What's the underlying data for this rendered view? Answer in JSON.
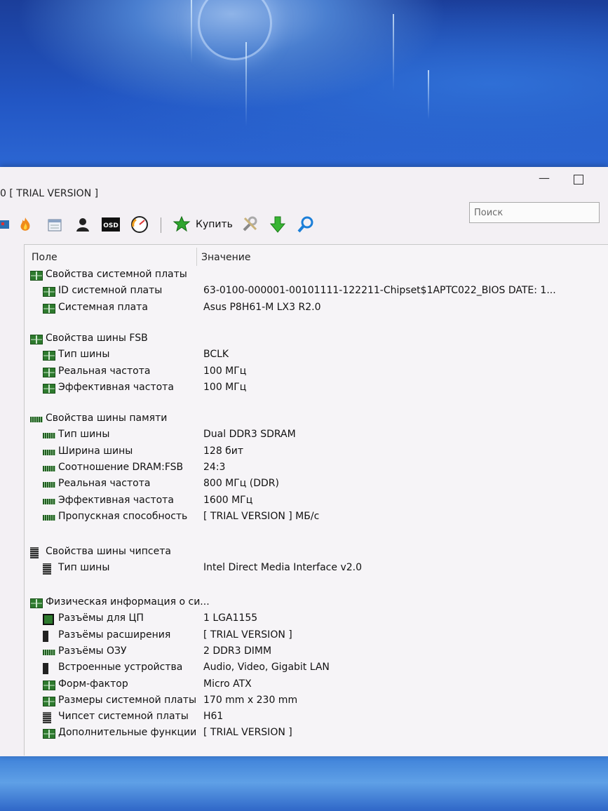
{
  "window": {
    "title": "0  [ TRIAL VERSION ]",
    "minimize_glyph": "—",
    "maximize_glyph": ""
  },
  "toolbar": {
    "icons": [
      "board-icon",
      "flame-icon",
      "calendar-icon",
      "user-icon",
      "osd-icon",
      "gauge-icon",
      "buy-icon",
      "tools-icon",
      "download-icon",
      "search-icon"
    ],
    "osd_text": "OSD",
    "buy_label": "Купить"
  },
  "search": {
    "placeholder": "Поиск",
    "value": ""
  },
  "columns": {
    "field": "Поле",
    "value": "Значение"
  },
  "groups": [
    {
      "title": "Свойства системной платы",
      "rows": [
        {
          "label": "ID системной платы",
          "value": "63-0100-000001-00101111-122211-Chipset$1APTC022_BIOS DATE: 1..."
        },
        {
          "label": "Системная плата",
          "value": "Asus P8H61-M LX3 R2.0"
        }
      ]
    },
    {
      "title": "Свойства шины FSB",
      "rows": [
        {
          "label": "Тип шины",
          "value": "BCLK"
        },
        {
          "label": "Реальная частота",
          "value": "100 МГц"
        },
        {
          "label": "Эффективная частота",
          "value": "100 МГц"
        }
      ]
    },
    {
      "title": "Свойства шины памяти",
      "rows": [
        {
          "label": "Тип шины",
          "value": "Dual DDR3 SDRAM"
        },
        {
          "label": "Ширина шины",
          "value": "128 бит"
        },
        {
          "label": "Соотношение DRAM:FSB",
          "value": "24:3"
        },
        {
          "label": "Реальная частота",
          "value": "800 МГц (DDR)"
        },
        {
          "label": "Эффективная частота",
          "value": "1600 МГц"
        },
        {
          "label": "Пропускная способность",
          "value": "[ TRIAL VERSION ] МБ/с"
        }
      ]
    },
    {
      "title": "Свойства шины чипсета",
      "rows": [
        {
          "label": "Тип шины",
          "value": "Intel Direct Media Interface v2.0"
        }
      ]
    },
    {
      "title": "Физическая информация о си...",
      "rows": [
        {
          "label": "Разъёмы для ЦП",
          "value": "1 LGA1155"
        },
        {
          "label": "Разъёмы расширения",
          "value": "[ TRIAL VERSION ]"
        },
        {
          "label": "Разъёмы ОЗУ",
          "value": "2 DDR3 DIMM"
        },
        {
          "label": "Встроенные устройства",
          "value": "Audio, Video, Gigabit LAN"
        },
        {
          "label": "Форм-фактор",
          "value": "Micro ATX"
        },
        {
          "label": "Размеры системной платы",
          "value": "170 mm x 230 mm"
        },
        {
          "label": "Чипсет системной платы",
          "value": "H61"
        },
        {
          "label": "Дополнительные функции",
          "value": "[ TRIAL VERSION ]"
        }
      ]
    }
  ]
}
